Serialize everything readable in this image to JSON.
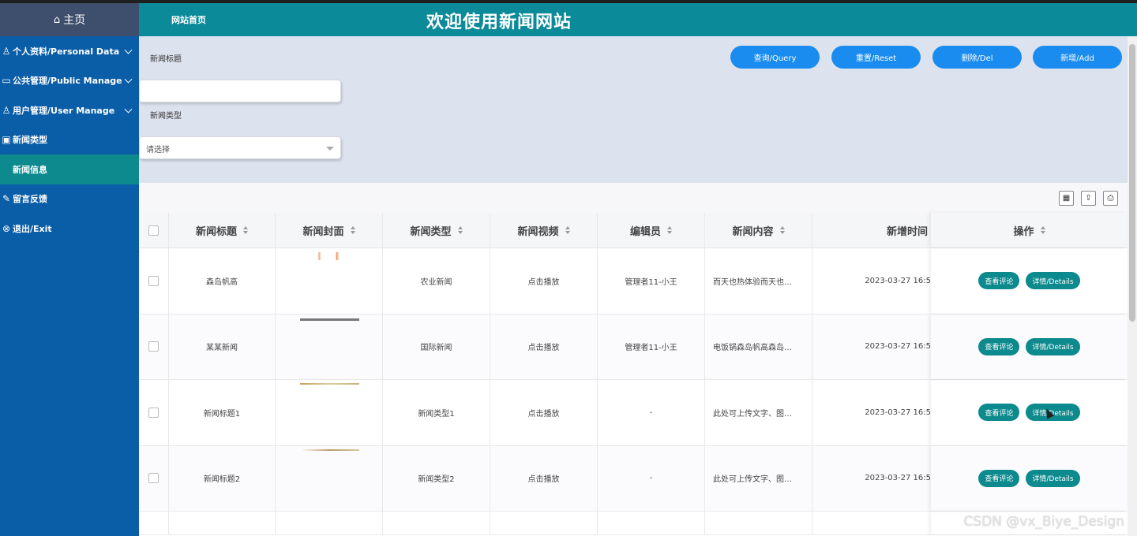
{
  "sidebar": {
    "home_label": "主页",
    "items": [
      {
        "label": "个人资料/Personal Data",
        "icon": "user-settings-icon",
        "expandable": true
      },
      {
        "label": "公共管理/Public Manage",
        "icon": "monitor-icon",
        "expandable": true
      },
      {
        "label": "用户管理/User Manage",
        "icon": "user-icon",
        "expandable": true
      },
      {
        "label": "新闻类型",
        "icon": "news-type-icon",
        "expandable": false
      },
      {
        "label": "新闻信息",
        "icon": "",
        "expandable": false,
        "active": true
      },
      {
        "label": "留言反馈",
        "icon": "feedback-icon",
        "expandable": false
      },
      {
        "label": "退出/Exit",
        "icon": "exit-icon",
        "expandable": false
      }
    ]
  },
  "header": {
    "site_link": "网站首页",
    "title": "欢迎使用新闻网站"
  },
  "search": {
    "title_label": "新闻标题",
    "title_value": "",
    "type_label": "新闻类型",
    "type_placeholder": "请选择",
    "buttons": {
      "query": "查询/Query",
      "reset": "重置/Reset",
      "delete": "删除/Del",
      "add": "新增/Add"
    }
  },
  "toolbar": {
    "icons": [
      "columns-icon",
      "export-icon",
      "print-icon"
    ]
  },
  "table": {
    "headers": [
      "新闻标题",
      "新闻封面",
      "新闻类型",
      "新闻视频",
      "编辑员",
      "新闻内容",
      "新增时间",
      "操作"
    ],
    "rows": [
      {
        "title": "森岛帆高",
        "type": "农业新闻",
        "video": "点击播放",
        "editor": "管理者11-小王",
        "content": "而天也热体验而天也…",
        "time": "2023-03-27 16:5"
      },
      {
        "title": "某某新闻",
        "type": "国际新闻",
        "video": "点击播放",
        "editor": "管理者11-小王",
        "content": "电饭锅森岛帆高森岛…",
        "time": "2023-03-27 16:5"
      },
      {
        "title": "新闻标题1",
        "type": "新闻类型1",
        "video": "点击播放",
        "editor": "-",
        "content": "此处可上传文字、图…",
        "time": "2023-03-27 16:5"
      },
      {
        "title": "新闻标题2",
        "type": "新闻类型2",
        "video": "点击播放",
        "editor": "-",
        "content": "此处可上传文字、图…",
        "time": "2023-03-27 16:5"
      }
    ],
    "action_comment": "查看评论",
    "action_details": "详情/Details"
  },
  "watermark": "CSDN @vx_Biye_Design",
  "colors": {
    "sidebar": "#0a5da7",
    "header": "#0b8a99",
    "active_item": "#0c8a8d",
    "primary_button": "#1a8cf0",
    "action_button": "#0c8a8d"
  }
}
